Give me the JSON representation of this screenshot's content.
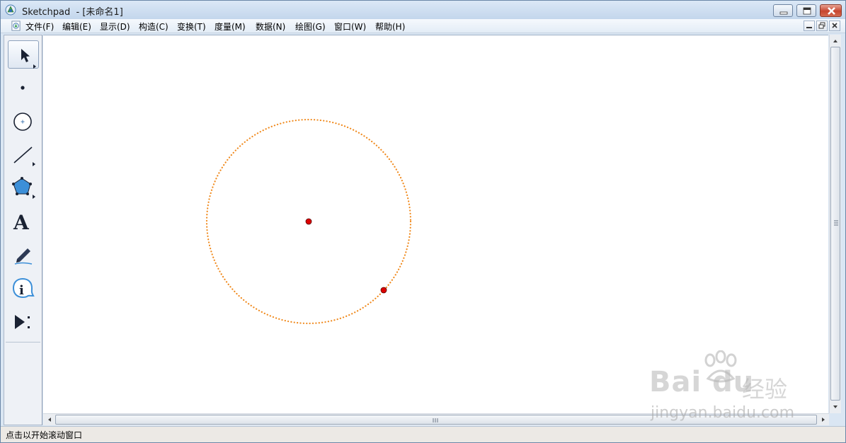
{
  "window": {
    "title": "Sketchpad  - [未命名1]",
    "app_icon": "sketchpad-logo-icon",
    "caption_buttons": [
      "minimize-icon",
      "restore-icon",
      "close-icon"
    ]
  },
  "menubar": {
    "items": [
      {
        "label": "文件(F)"
      },
      {
        "label": "编辑(E)"
      },
      {
        "label": "显示(D)"
      },
      {
        "label": "构造(C)"
      },
      {
        "label": "变换(T)"
      },
      {
        "label": "度量(M)"
      },
      {
        "label": "数据(N)"
      },
      {
        "label": "绘图(G)"
      },
      {
        "label": "窗口(W)"
      },
      {
        "label": "帮助(H)"
      }
    ],
    "mdi_buttons": [
      "minimize-icon",
      "restore-icon",
      "close-icon"
    ]
  },
  "toolbox": {
    "tools": [
      {
        "name": "selection-arrow-tool",
        "icon": "arrow-icon",
        "active": true
      },
      {
        "name": "point-tool",
        "icon": "point-icon"
      },
      {
        "name": "compass-tool",
        "icon": "circle-icon"
      },
      {
        "name": "straightedge-tool",
        "icon": "segment-icon"
      },
      {
        "name": "polygon-tool",
        "icon": "pentagon-icon"
      },
      {
        "name": "text-tool",
        "icon": "text-A-icon",
        "glyph": "A"
      },
      {
        "name": "marker-tool",
        "icon": "pen-icon"
      },
      {
        "name": "information-tool",
        "icon": "info-icon",
        "glyph": "i"
      },
      {
        "name": "custom-tool",
        "icon": "play-icon"
      }
    ]
  },
  "canvas": {
    "objects": [
      {
        "type": "circle",
        "style": "dotted",
        "color": "#f08a1e"
      },
      {
        "type": "point",
        "role": "center",
        "color": "#dd0000"
      },
      {
        "type": "point",
        "role": "on-circle",
        "color": "#dd0000"
      }
    ]
  },
  "statusbar": {
    "text": "点击以开始滚动窗口"
  },
  "watermark": {
    "logo": "Bai du",
    "cn": "经验",
    "url": "jingyan.baidu.com"
  }
}
